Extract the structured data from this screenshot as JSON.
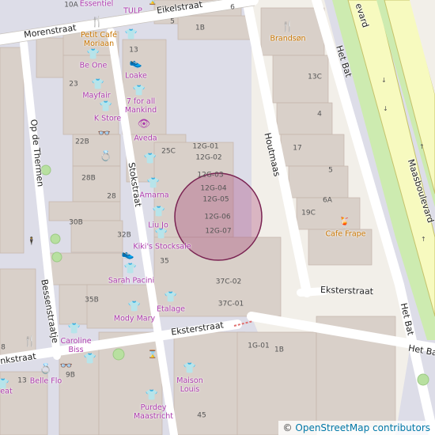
{
  "streets": {
    "morenstraat": "Morenstraat",
    "eikelstraat": "Eikelstraat",
    "op_de_thermen": "Op de Thermen",
    "stokstraat": "Stokstraat",
    "houtmaas": "Houtmaas",
    "het_bat_top": "Het Bat",
    "het_bat_bottom": "Het Bat",
    "het_bat_corner": "Het Bat",
    "maasboulevard": "Maasboulevard",
    "maasboulevard_top": "evard",
    "eksterstraat_east": "Eksterstraat",
    "eksterstraat_west": "Eksterstraat",
    "bessenstraatje": "Bessenstraatje",
    "west_partial": "nkstraat"
  },
  "pois": {
    "essentiel": "Essentiel",
    "tulp": "TULP",
    "petit_cafe": "Petit Café\nMoriaan",
    "be_one": "Be One",
    "loake": "Loake",
    "mayfair": "Mayfair",
    "seven_for_all": "7 for all\nMankind",
    "k_store": "K Store",
    "aveda": "Aveda",
    "amarna": "Amarna",
    "liu_jo": "Liu Jo",
    "kikis": "Kiki's Stocksale",
    "sarah_pacini": "Sarah Pacini",
    "mody_mary": "Mody Mary",
    "etalage": "Etalage",
    "caroline_biss": "Caroline\nBiss",
    "belle_flo": "Belle Flo",
    "maison_louis": "Maison\nLouis",
    "purdey": "Purdey\nMaastricht",
    "brandson": "Brandsøn",
    "cafe_frape": "Cafe Frape",
    "beat": "eat"
  },
  "addresses": {
    "a10A": "10A",
    "a6": "6",
    "a5": "5",
    "a1B": "1B",
    "a13": "13",
    "a23": "23",
    "a22B": "22B",
    "a25C": "25C",
    "a28B": "28B",
    "a28": "28",
    "a30B": "30B",
    "a32B": "32B",
    "a35": "35",
    "a35B": "35B",
    "a9B": "9B",
    "a13b": "13",
    "a45": "45",
    "a8": "8",
    "a12G01": "12G-01",
    "a12G02": "12G-02",
    "a12G03": "12G-03",
    "a12G04": "12G-04",
    "a12G05": "12G-05",
    "a12G06": "12G-06",
    "a12G07": "12G-07",
    "a37C02": "37C-02",
    "a37C01": "37C-01",
    "a13C": "13C",
    "a4": "4",
    "a17": "17",
    "a5b": "5",
    "a6A": "6A",
    "a19C": "19C",
    "a1G01": "1G-01",
    "a1Bb": "1B"
  },
  "attribution": {
    "prefix": "© ",
    "link": "OpenStreetMap contributors"
  },
  "colors": {
    "background": "#f2efe9",
    "building": "#d9d0c9",
    "pedestrian": "#dddde8",
    "road": "#ffffff",
    "motorway": "#f7fabf",
    "grass": "#cdebb0",
    "shop": "#ac39ac",
    "food": "#c77400",
    "highlight": "#a0306a"
  }
}
